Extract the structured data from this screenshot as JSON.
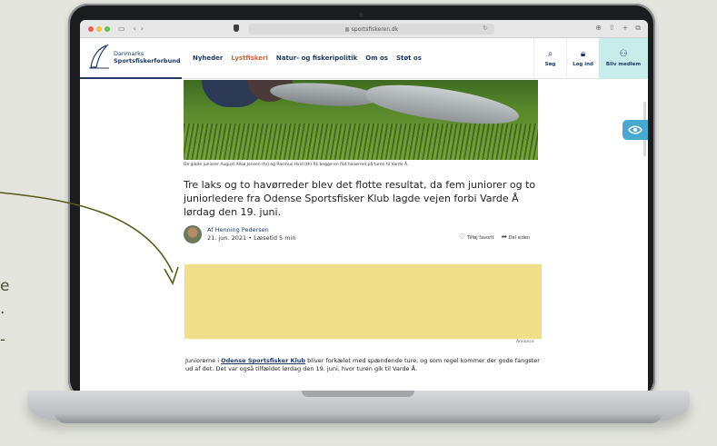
{
  "side_fragment": [
    "e",
    ".",
    "-"
  ],
  "browser": {
    "url": "sportsfiskeren.dk"
  },
  "site": {
    "logo_line1": "Danmarks",
    "logo_line2": "Sportsfiskerforbund",
    "menu": [
      "Nyheder",
      "Lystfiskeri",
      "Natur- og fiskeripolitik",
      "Om os",
      "Støt os"
    ],
    "active_menu": "Lystfiskeri",
    "actions": {
      "search": "Søg",
      "login": "Log ind",
      "member": "Bliv medlem"
    }
  },
  "article": {
    "caption": "De glade juniorer August Allsø Jensen (tv) og Rasmus Hvid (th) fik begge en flot havørred på turen til Varde Å.",
    "headline": "Tre laks og to havørreder blev det flotte resultat, da fem juniorer og to juniorledere fra Odense Sportsfisker Klub lagde vejen forbi Varde Å lørdag den 19. juni.",
    "author": "Af Henning Pedersen",
    "meta": "21. jun. 2021 • Læsetid 5 min",
    "favorite": "Tilføj favorit",
    "share": "Del siden",
    "ad_label": "Annonce",
    "body_prefix": "Juniorerne i ",
    "body_link": "Odense Sportsfisker Klub",
    "body_suffix": " bliver forkælet med spændende ture, og som regel kommer der gode fangster ud af det. Det var også tilfældet lørdag den 19. juni, hvor turen gik til Varde Å."
  },
  "colors": {
    "brand": "#1d3b66",
    "accent": "#c9663a",
    "ad": "#f0de89",
    "member": "#c8ecea",
    "eye": "#48a8d0",
    "arrow": "#5a5a16"
  }
}
